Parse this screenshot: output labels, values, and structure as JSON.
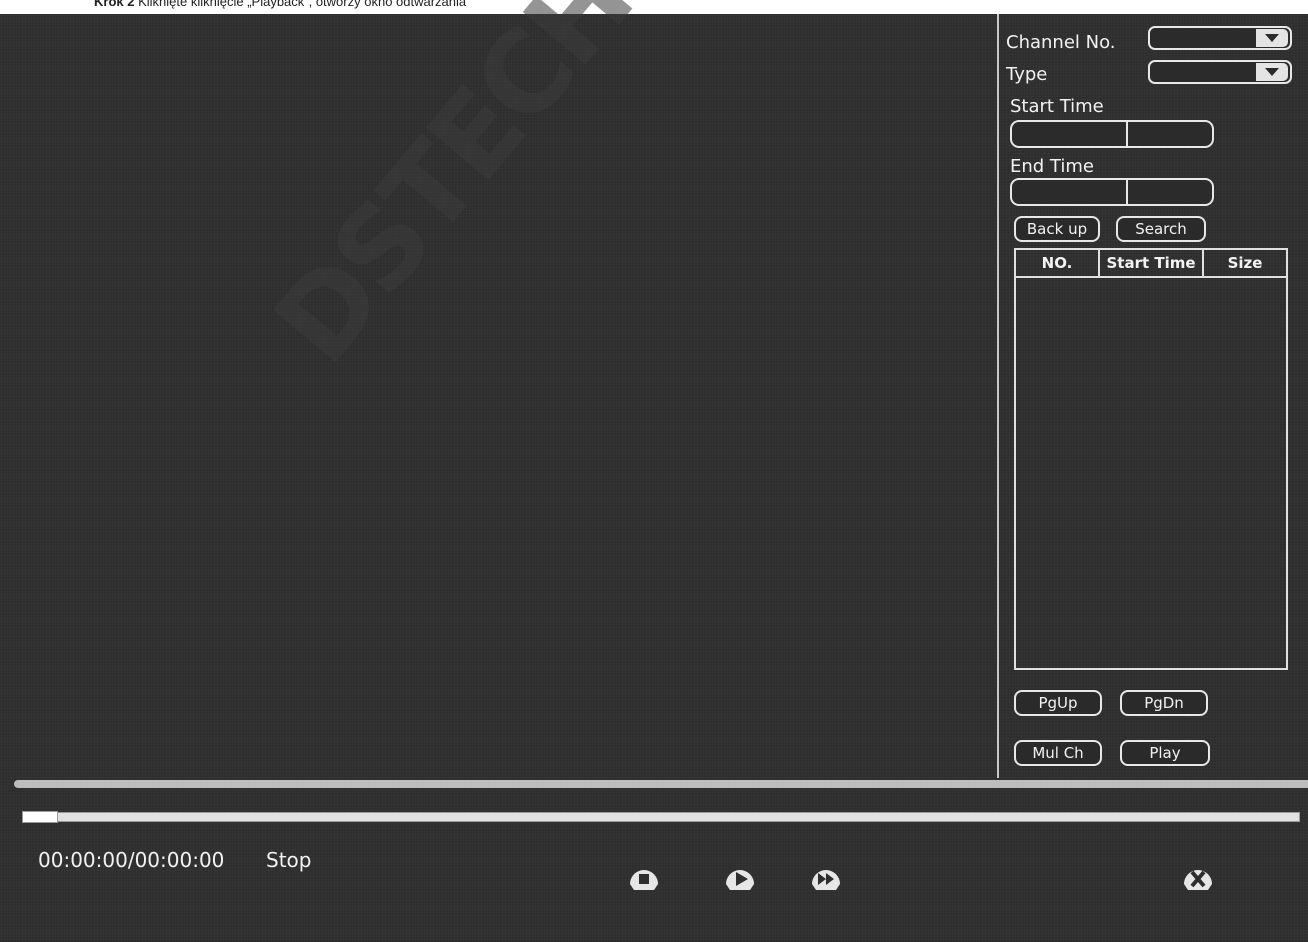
{
  "caption": {
    "prefix": "Krok 2",
    "text": "Kliknięte kliknięcie „Playback”, otworzy okno odtwarzania"
  },
  "watermark": "DSTECHNIK",
  "sidebar": {
    "channel_label": "Channel  No.",
    "channel_value": "",
    "type_label": "Type",
    "type_value": "",
    "start_time_label": "Start Time",
    "end_time_label": "End Time",
    "backup_button": "Back up",
    "search_button": "Search",
    "table": {
      "columns": [
        "NO.",
        "Start Time",
        "Size"
      ],
      "rows": []
    },
    "pgup_button": "PgUp",
    "pgdn_button": "PgDn",
    "mulch_button": "Mul Ch",
    "play_button": "Play"
  },
  "player": {
    "time": "00:00:00/00:00:00",
    "status": "Stop",
    "progress": 0,
    "icons": [
      "stop-icon",
      "play-icon",
      "fast-forward-icon",
      "exit-icon"
    ]
  },
  "colors": {
    "background": "#2e2e2e",
    "foreground": "#f0f0f0",
    "control_fill": "#e4e4e4"
  }
}
